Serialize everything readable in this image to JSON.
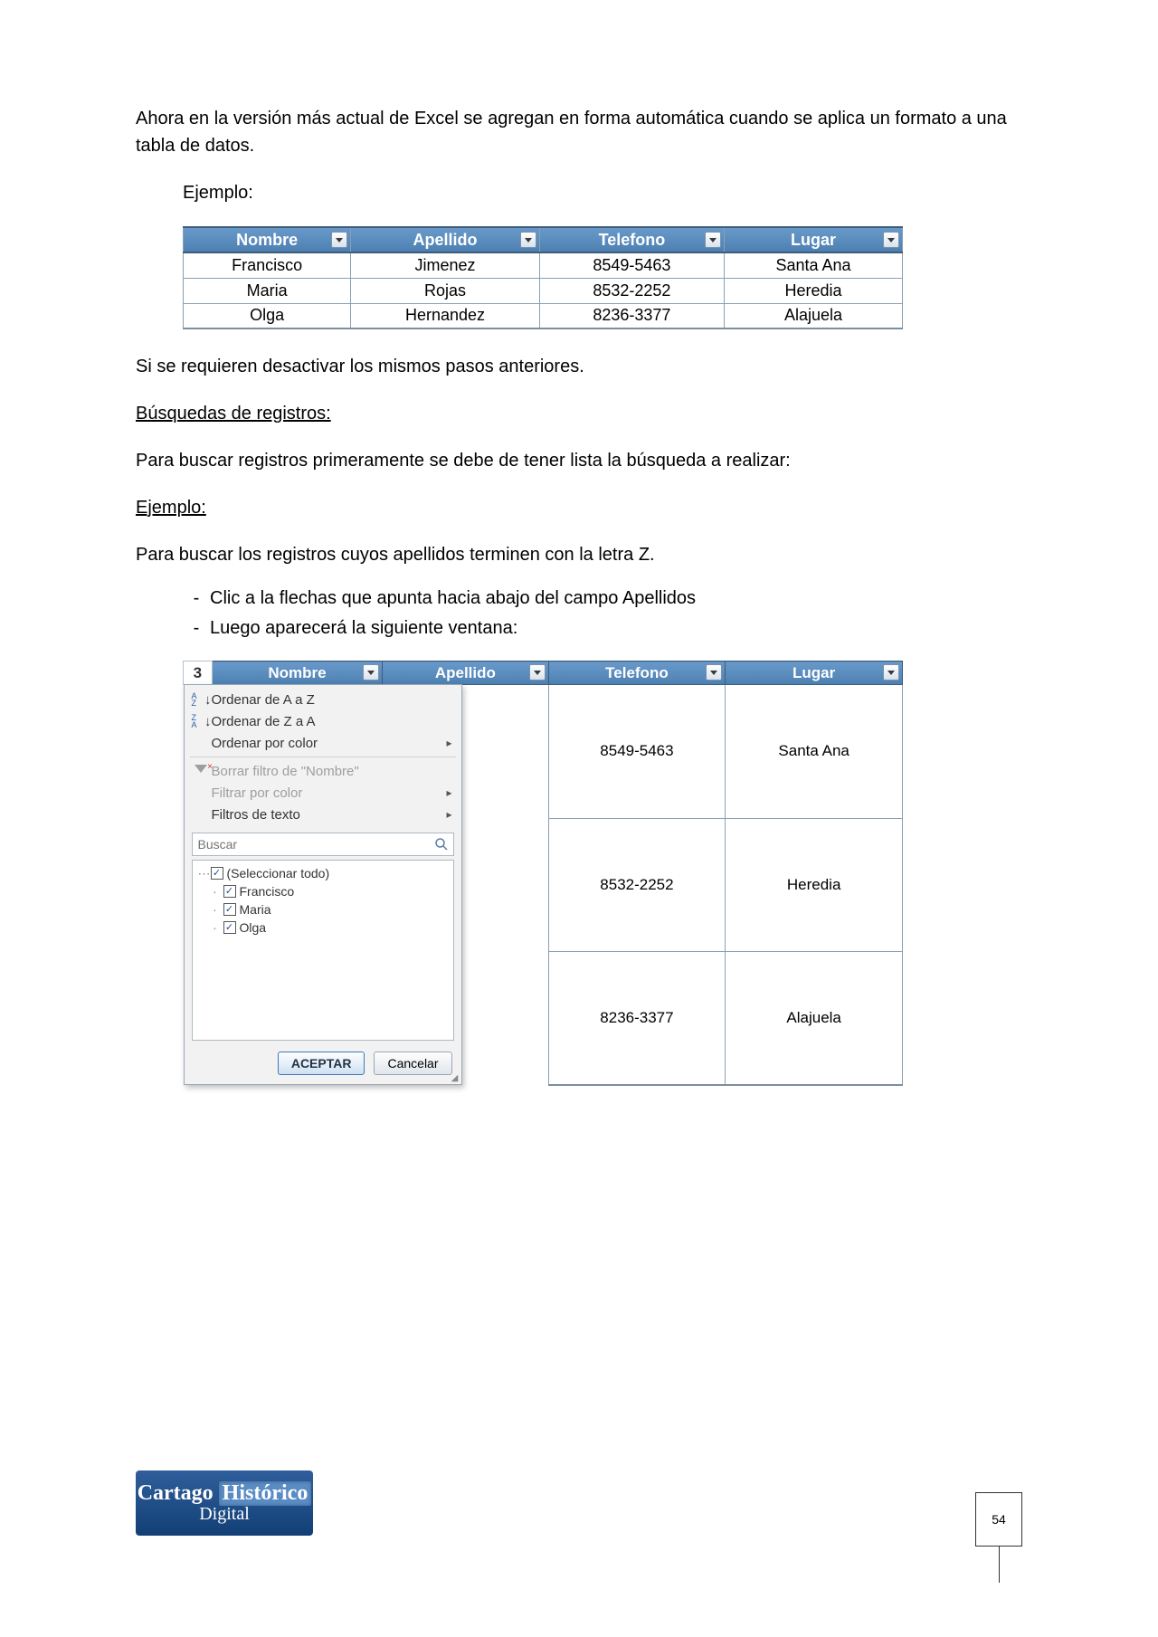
{
  "para1": "Ahora en la versión más actual de Excel se agregan en forma automática cuando se aplica un formato a una tabla de datos.",
  "example_label": "Ejemplo:",
  "table1": {
    "headers": {
      "c1": "Nombre",
      "c2": "Apellido",
      "c3": "Telefono",
      "c4": "Lugar"
    },
    "rows": [
      {
        "c1": "Francisco",
        "c2": "Jimenez",
        "c3": "8549-5463",
        "c4": "Santa Ana"
      },
      {
        "c1": "Maria",
        "c2": "Rojas",
        "c3": "8532-2252",
        "c4": "Heredia"
      },
      {
        "c1": "Olga",
        "c2": "Hernandez",
        "c3": "8236-3377",
        "c4": "Alajuela"
      }
    ]
  },
  "para2": "Si se requieren desactivar los mismos pasos anteriores.",
  "heading_busquedas": "Búsquedas de registros:",
  "para3": "Para buscar registros primeramente se debe de tener lista la búsqueda a realizar:",
  "example2_label": "Ejemplo:",
  "para4": "Para buscar los registros cuyos apellidos terminen con la letra Z.",
  "steps": {
    "s1": "Clic a la flechas que apunta hacia abajo del campo Apellidos",
    "s2": "Luego aparecerá la siguiente ventana:"
  },
  "dash": "-",
  "table2": {
    "rownum": "3",
    "headers": {
      "c1": "Nombre",
      "c2": "Apellido",
      "c3": "Telefono",
      "c4": "Lugar"
    },
    "rows": [
      {
        "c3": "8549-5463",
        "c4": "Santa Ana"
      },
      {
        "c3": "8532-2252",
        "c4": "Heredia"
      },
      {
        "c3": "8236-3377",
        "c4": "Alajuela"
      }
    ]
  },
  "filter": {
    "sort_az": "Ordenar de A a Z",
    "sort_za": "Ordenar de Z a A",
    "sort_color": "Ordenar por color",
    "clear_filter": "Borrar filtro de \"Nombre\"",
    "filter_color": "Filtrar por color",
    "text_filters": "Filtros de texto",
    "search_placeholder": "Buscar",
    "items": {
      "all": "(Seleccionar todo)",
      "i1": "Francisco",
      "i2": "Maria",
      "i3": "Olga"
    },
    "ok": "ACEPTAR",
    "cancel": "Cancelar"
  },
  "footer": {
    "logo_a": "Cartago",
    "logo_b": "Histórico",
    "logo_c": "Digital",
    "page_number": "54"
  }
}
